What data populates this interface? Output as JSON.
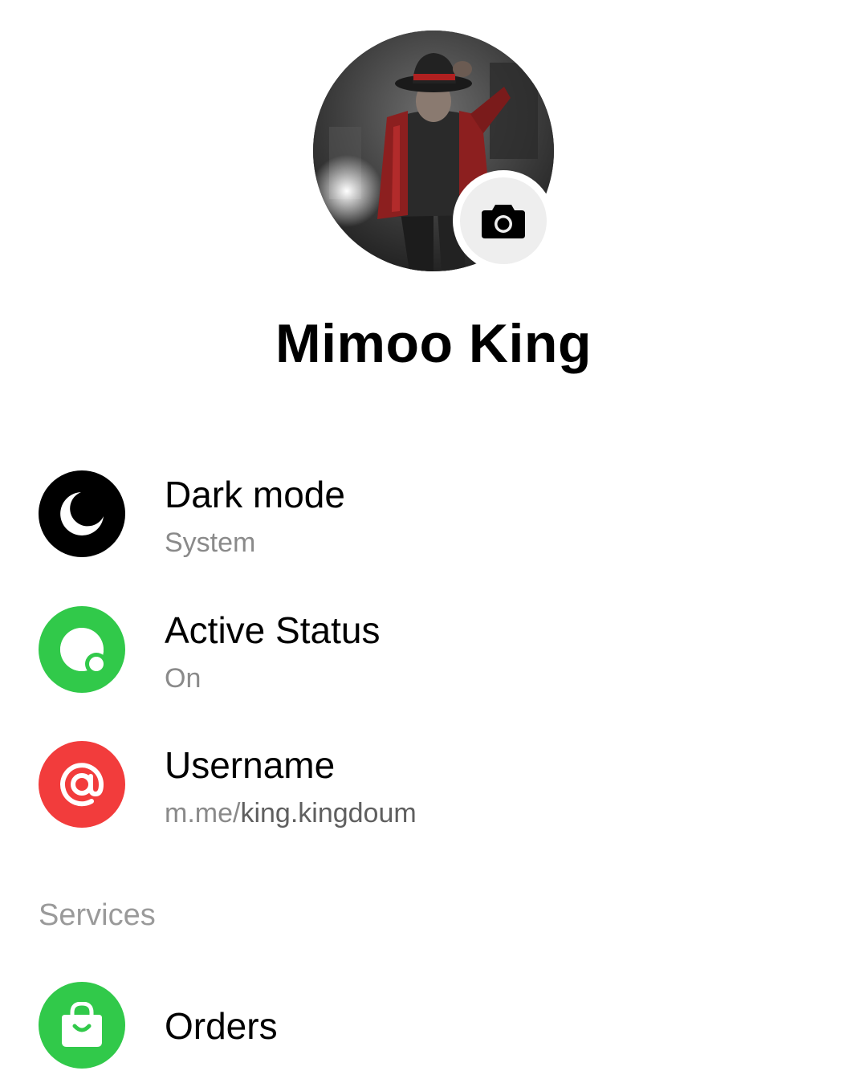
{
  "profile": {
    "name": "Mimoo King",
    "avatar_icon": "profile-photo",
    "change_photo_icon": "camera-icon"
  },
  "settings": [
    {
      "title": "Dark mode",
      "subtitle": "System",
      "icon": "moon-icon",
      "icon_color": "#000000"
    },
    {
      "title": "Active Status",
      "subtitle": "On",
      "icon": "active-status-icon",
      "icon_color": "#31c94a"
    },
    {
      "title": "Username",
      "subtitle_prefix": "m.me/",
      "subtitle_value": "king.kingdoum",
      "icon": "at-sign-icon",
      "icon_color": "#f23c3c"
    }
  ],
  "services": {
    "header": "Services",
    "items": [
      {
        "title": "Orders",
        "icon": "shopping-bag-icon",
        "icon_color": "#31c94a"
      }
    ]
  }
}
